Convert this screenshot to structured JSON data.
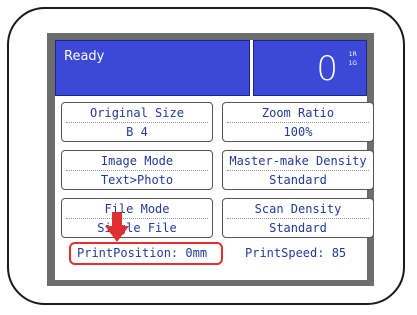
{
  "status": {
    "text": "Ready"
  },
  "counter": {
    "value": "0",
    "sub_top": "1R",
    "sub_bottom": "1G"
  },
  "panels": [
    {
      "title": "Original Size",
      "value": "B 4"
    },
    {
      "title": "Zoom Ratio",
      "value": "100%"
    },
    {
      "title": "Image Mode",
      "value": "Text>Photo"
    },
    {
      "title": "Master-make Density",
      "value": "Standard"
    },
    {
      "title": "File Mode",
      "value": "Single File"
    },
    {
      "title": "Scan Density",
      "value": "Standard"
    }
  ],
  "footer": {
    "print_position": "PrintPosition: 0mm",
    "print_speed": "PrintSpeed: 85"
  },
  "colors": {
    "status_bar": "#3b49d6",
    "text_blue": "#233a9a",
    "highlight_red": "#e03030",
    "bezel": "#6d6d6d"
  }
}
